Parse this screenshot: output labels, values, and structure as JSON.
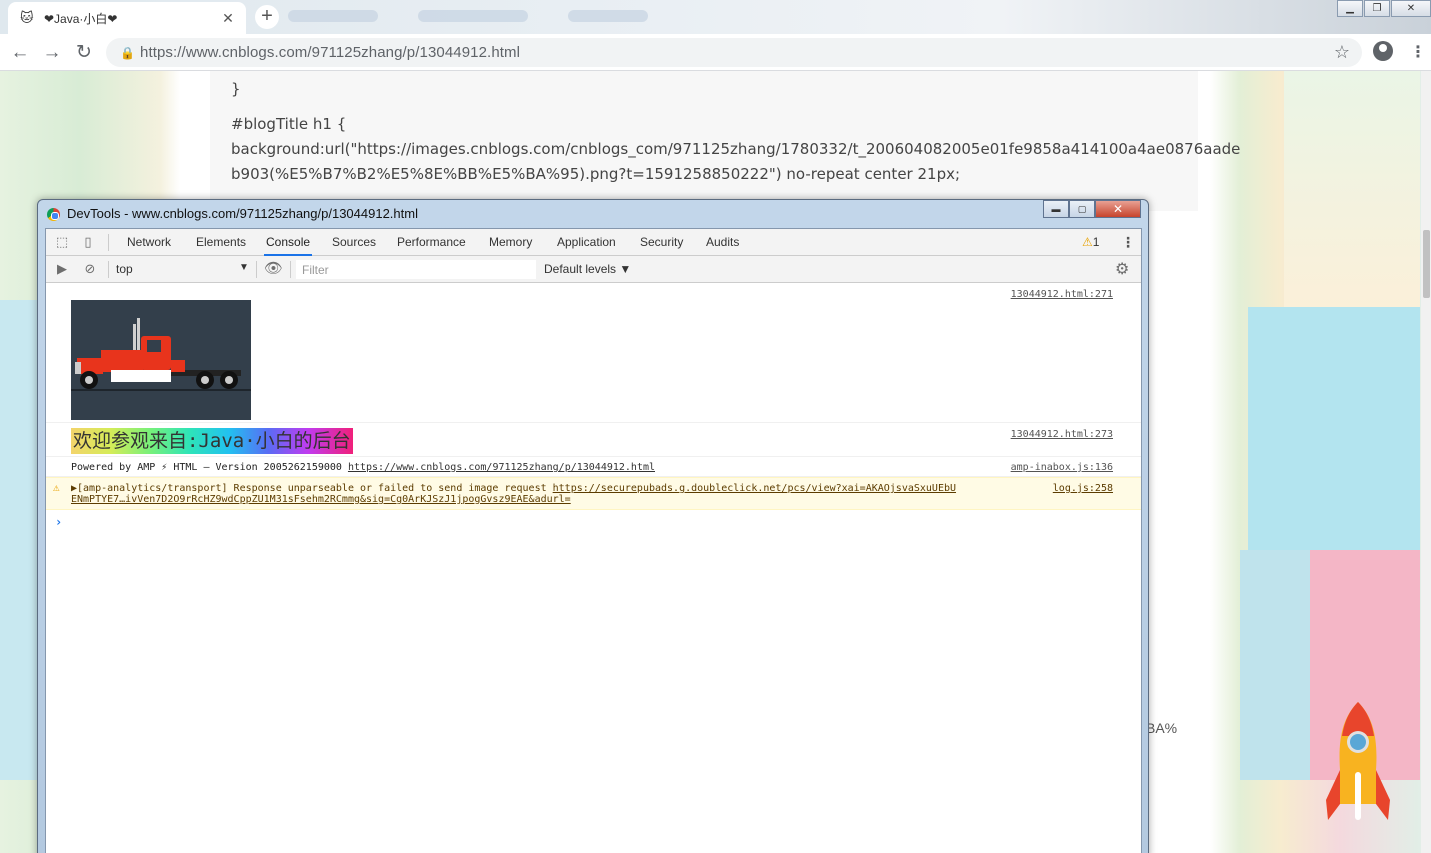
{
  "browser": {
    "tab": {
      "title": "❤Java·小白❤",
      "close_icon": "close-icon",
      "favicon": "🐱"
    },
    "window_controls": {
      "minimize": "▁",
      "maximize": "❐",
      "close": "✕"
    },
    "toolbar": {
      "back": "←",
      "forward": "→",
      "reload": "↻",
      "url": "https://www.cnblogs.com/971125zhang/p/13044912.html",
      "star": "☆",
      "menu": "⋮"
    }
  },
  "page": {
    "code_lines": [
      "}",
      "#blogTitle h1 {",
      "background:url(\"https://images.cnblogs.com/cnblogs_com/971125zhang/1780332/t_200604082005e01fe9858a414100a4ae0876aade",
      "b903(%E5%B7%B2%E5%8E%BB%E5%BA%95).png?t=1591258850222\") no-repeat center 21px;"
    ],
    "trailing_text": "BA%"
  },
  "devtools": {
    "title": "DevTools - www.cnblogs.com/971125zhang/p/13044912.html",
    "window_controls": {
      "minimize": "▬",
      "maximize": "▢",
      "close": "✕"
    },
    "tabs": [
      "Network",
      "Elements",
      "Console",
      "Sources",
      "Performance",
      "Memory",
      "Application",
      "Security",
      "Audits"
    ],
    "active_tab": "Console",
    "warning_count": "1",
    "console_bar": {
      "context": "top",
      "filter_placeholder": "Filter",
      "levels": "Default levels ▼"
    },
    "messages": {
      "img_src": "13044912.html:271",
      "styled_src": "13044912.html:273",
      "styled_text": "欢迎参观来自:Java·小白的后台",
      "amp_prefix": "Powered by AMP ⚡ HTML – Version 2005262159000 ",
      "amp_link": "https://www.cnblogs.com/971125zhang/p/13044912.html",
      "amp_src": "amp-inabox.js:136",
      "warn_prefix": "▶[amp-analytics/transport] Response unparseable or failed to send image request ",
      "warn_link1": "https://securepubads.g.doubleclick.net/pcs/view?xai=AKAOjsvaSxuUEbU",
      "warn_link2": "ENmPTYE7…ivVen7D2O9rRcHZ9wdCppZU1M31sFsehm2RCmmg&sig=Cg0ArKJSzJ1jpogGvsz9EAE&adurl=",
      "warn_src": "log.js:258",
      "prompt": "›"
    }
  },
  "colors": {
    "accent": "#1a73e8",
    "warning": "#e8a200",
    "warning_bg": "#fffbe5"
  }
}
